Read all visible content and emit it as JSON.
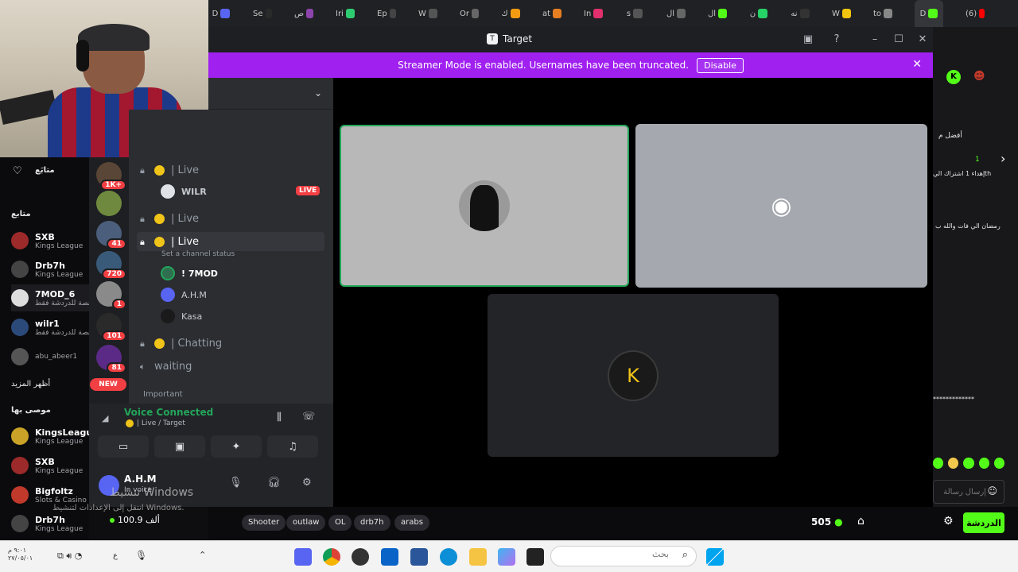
{
  "browser": {
    "tabs": [
      "D",
      "Se",
      "ص",
      "Iri",
      "Ep",
      "W",
      "Or",
      "ك",
      "at",
      "In",
      "s",
      "ال",
      "ال",
      "ن",
      "نه",
      "W",
      "to",
      "D",
      "(6)"
    ],
    "nav": {
      "refresh": "⟳",
      "back": "←",
      "forward": "→"
    }
  },
  "discord": {
    "window_title": "Target",
    "banner": {
      "message": "Streamer Mode is enabled. Usernames have been truncated.",
      "button": "Disable"
    },
    "servers": [
      {
        "badge": "1K+",
        "color": "#5a4636"
      },
      {
        "badge": "",
        "color": "#6f8a3e"
      },
      {
        "badge": "41",
        "color": "#4b5f7c"
      },
      {
        "badge": "720",
        "color": "#3a5a7a"
      },
      {
        "badge": "1",
        "color": "#8a8a8a"
      },
      {
        "badge": "101",
        "color": "#2a2a2a"
      },
      {
        "badge": "81",
        "color": "#5b2a86"
      }
    ],
    "new_badge": "NEW",
    "channels": [
      {
        "name": "| Live"
      },
      {
        "name": "| Live"
      },
      {
        "name": "| Live"
      },
      {
        "name": "| Chatting"
      }
    ],
    "live_user": {
      "name": "WILR",
      "badge": "LIVE"
    },
    "channel_status": "Set a channel status",
    "voice_users": [
      "! 7MOD",
      "A.H.M",
      "Kasa"
    ],
    "waiting": "waiting",
    "category_important": "Important",
    "voice": {
      "status": "Voice Connected",
      "location": "| Live / Target"
    },
    "user": {
      "name": "A.H.M",
      "status": "In voice"
    }
  },
  "kick": {
    "following_title": "متابع",
    "following_label": "متابَع",
    "following": [
      {
        "name": "SXB",
        "game": "Kings League",
        "color": "#9c2a2a"
      },
      {
        "name": "Drb7h",
        "game": "Kings League",
        "color": "#444"
      },
      {
        "name": "7MOD_6",
        "game": "منصة للدردشة فقط",
        "color": "#ddd"
      },
      {
        "name": "wilr1",
        "game": "منصة للدردشة فقط",
        "color": "#2b4a7a"
      },
      {
        "name": "abu_abeer1",
        "game": "",
        "color": "#555"
      }
    ],
    "show_more": "أظهر المزيد",
    "recommended_title": "موصى بها",
    "recommended": [
      {
        "name": "KingsLeague",
        "game": "Kings League",
        "color": "#c9a227"
      },
      {
        "name": "SXB",
        "game": "Kings League",
        "color": "#9c2a2a"
      },
      {
        "name": "Bigfoltz",
        "game": "Slots & Casino",
        "color": "#c0392b"
      },
      {
        "name": "Drb7h",
        "game": "Kings League",
        "color": "#444"
      }
    ],
    "followers_count": "100.9 ألف",
    "tags": [
      "Shooter",
      "outlaw",
      "OL",
      "drb7h",
      "arabs"
    ],
    "viewers": "505",
    "chat_button": "الدردشة",
    "chat_placeholder": "إرسال رسالة",
    "chat_lines": [
      "أفضل م",
      "1",
      "إهداء 1 اشتراك الي",
      "th",
      "رمضان الي فات والله ب",
      "*************"
    ]
  },
  "windows": {
    "watermark_title": "تنشيط Windows",
    "watermark_sub": "انتقل إلى الإعدادات لتنشيط Windows.",
    "search_placeholder": "بحث",
    "clock_time": "٩:٠١ م",
    "clock_date": "٢٧/٠٥/٠١",
    "lang": "ع"
  }
}
